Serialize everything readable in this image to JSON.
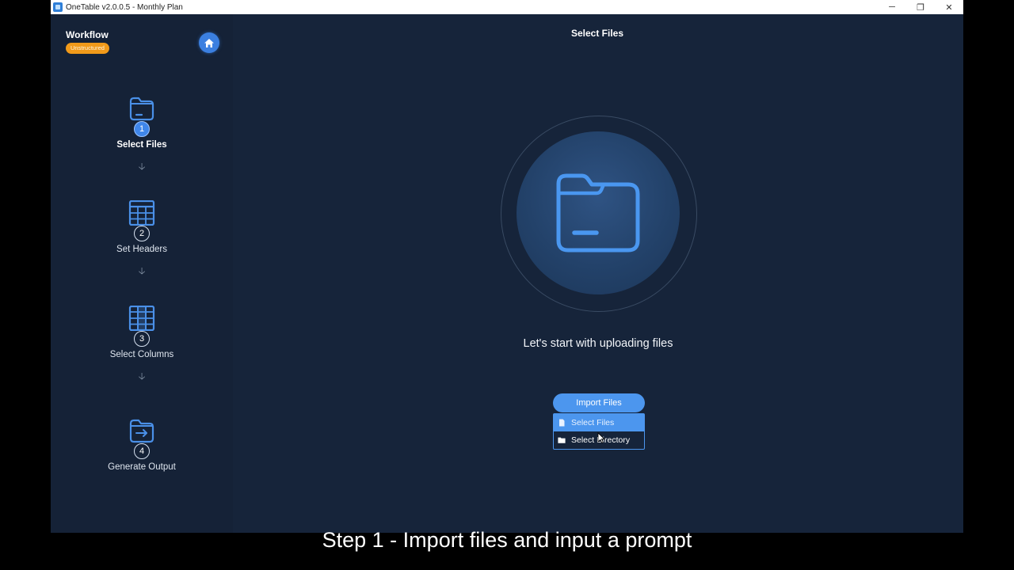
{
  "window": {
    "title": "OneTable v2.0.0.5 - Monthly Plan",
    "controls": {
      "minimize": "─",
      "restore": "❐",
      "close": "✕"
    }
  },
  "sidebar": {
    "title": "Workflow",
    "badge": "Unstructured",
    "steps": [
      {
        "number": "1",
        "label": "Select Files",
        "icon": "folder-icon",
        "active": true
      },
      {
        "number": "2",
        "label": "Set Headers",
        "icon": "table-icon",
        "active": false
      },
      {
        "number": "3",
        "label": "Select Columns",
        "icon": "columns-icon",
        "active": false
      },
      {
        "number": "4",
        "label": "Generate Output",
        "icon": "folder-export-icon",
        "active": false
      }
    ],
    "arrow": "🡣"
  },
  "main": {
    "title": "Select Files",
    "hero_icon": "folder-icon",
    "hero_text": "Let's start with uploading files",
    "import_button": "Import Files",
    "dropdown": [
      {
        "label": "Select Files",
        "icon": "file-icon",
        "hovered": true
      },
      {
        "label": "Select Directory",
        "icon": "directory-icon",
        "hovered": false
      }
    ]
  },
  "caption": "Step 1 - Import files and input a prompt",
  "colors": {
    "background": "#16243a",
    "sidebar": "#152237",
    "accent": "#4c96ee",
    "badge": "#f19a1a",
    "icon_stroke": "#4a90e8"
  }
}
